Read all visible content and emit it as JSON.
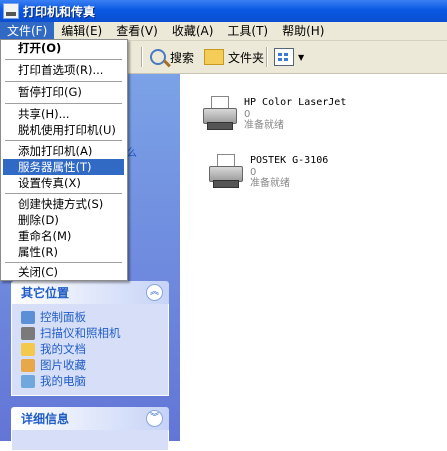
{
  "window": {
    "title": "打印机和传真"
  },
  "menubar": [
    {
      "label": "文件(F)",
      "active": true
    },
    {
      "label": "编辑(E)"
    },
    {
      "label": "查看(V)"
    },
    {
      "label": "收藏(A)"
    },
    {
      "label": "工具(T)"
    },
    {
      "label": "帮助(H)"
    }
  ],
  "toolbar": {
    "search": "搜索",
    "folders": "文件夹",
    "views_icon": "view-grid-icon"
  },
  "file_menu": {
    "open": "打开(O)",
    "prefs": "打印首选项(R)...",
    "pause": "暂停打印(G)",
    "share": "共享(H)...",
    "offline": "脱机使用打印机(U)",
    "add_printer": "添加打印机(A)",
    "server_props": "服务器属性(T)",
    "setup_fax": "设置传真(X)",
    "shortcut": "创建快捷方式(S)",
    "delete": "删除(D)",
    "rename": "重命名(M)",
    "properties": "属性(R)",
    "close": "关闭(C)"
  },
  "sidebar": {
    "tasks_fragment": "么",
    "other_places": {
      "title": "其它位置",
      "items": [
        "控制面板",
        "扫描仪和照相机",
        "我的文档",
        "图片收藏",
        "我的电脑"
      ]
    },
    "details": {
      "title": "详细信息"
    }
  },
  "printers": [
    {
      "name": "HP Color LaserJet",
      "count": "0",
      "status": "准备就绪"
    },
    {
      "name": "POSTEK G-3106",
      "count": "0",
      "status": "准备就绪"
    }
  ],
  "colors": {
    "titlebar": "#0a58e2",
    "highlight": "#316ac5",
    "sidebar": "#6f8fe0",
    "link": "#215dc6"
  }
}
